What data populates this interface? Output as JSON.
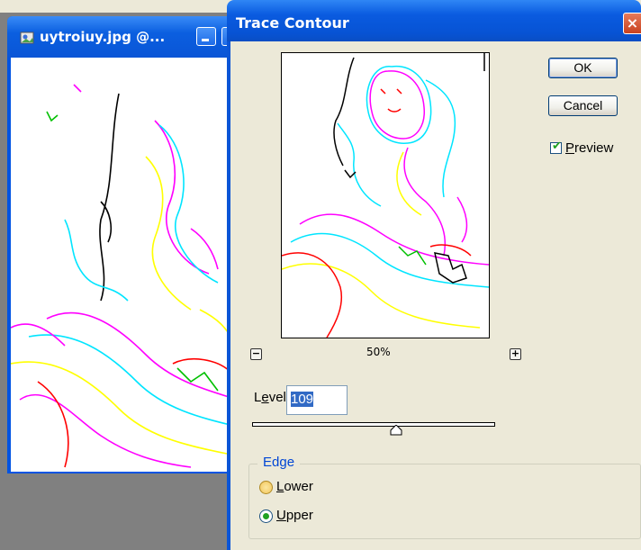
{
  "document_window": {
    "title": "uytroiuy.jpg @...",
    "icon": "image-file-icon"
  },
  "dialog": {
    "title": "Trace Contour",
    "close_glyph": "×",
    "preview_zoom": "50%",
    "zoom_out_glyph": "−",
    "zoom_in_glyph": "+",
    "buttons": {
      "ok": "OK",
      "cancel": "Cancel"
    },
    "preview_checkbox": {
      "label_first": "P",
      "label_rest": "review",
      "checked": true
    },
    "level": {
      "label_first": "L",
      "label_rest": "evel:",
      "value": "109",
      "slider_fraction": 0.6
    },
    "edge": {
      "legend": "Edge",
      "options": [
        {
          "first": "L",
          "rest": "ower",
          "selected": false
        },
        {
          "first": "U",
          "rest": "pper",
          "selected": true
        }
      ]
    }
  },
  "colors": {
    "xp_title_blue": "#0a55d6",
    "dialog_face": "#ece9d8",
    "contour_magenta": "#ff00ff",
    "contour_cyan": "#00e5ff",
    "contour_yellow": "#ffff00",
    "contour_red": "#ff0000",
    "contour_green": "#00c000",
    "contour_black": "#000000"
  }
}
